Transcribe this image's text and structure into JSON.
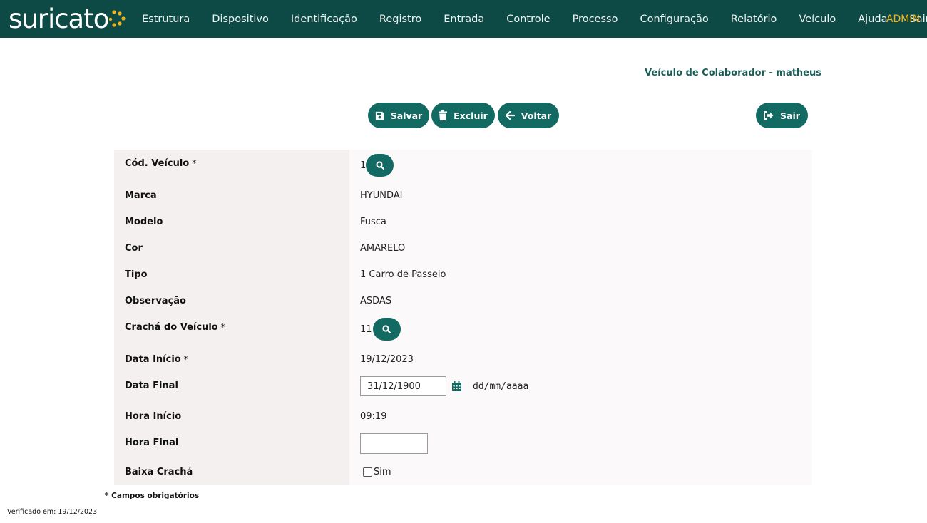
{
  "app": {
    "logo_text": "suricato",
    "user_label": "ADMIN"
  },
  "nav": {
    "items": [
      "Estrutura",
      "Dispositivo",
      "Identificação",
      "Registro",
      "Entrada",
      "Controle",
      "Processo",
      "Configuração",
      "Relatório",
      "Veículo",
      "Ajuda",
      "Sair"
    ]
  },
  "page": {
    "title": "Veículo de Colaborador - matheus"
  },
  "toolbar": {
    "save_label": "Salvar",
    "delete_label": "Excluir",
    "back_label": "Voltar",
    "exit_label": "Sair"
  },
  "form": {
    "required_mark": "*",
    "cod_veiculo": {
      "label": "Cód. Veículo",
      "value": "1"
    },
    "marca": {
      "label": "Marca",
      "value": "HYUNDAI"
    },
    "modelo": {
      "label": "Modelo",
      "value": "Fusca"
    },
    "cor": {
      "label": "Cor",
      "value": "AMARELO"
    },
    "tipo": {
      "label": "Tipo",
      "value": "1 Carro de Passeio"
    },
    "observacao": {
      "label": "Observação",
      "value": "ASDAS"
    },
    "cracha": {
      "label": "Crachá do Veículo",
      "value": "11"
    },
    "data_inicio": {
      "label": "Data Início",
      "value": "19/12/2023"
    },
    "data_final": {
      "label": "Data Final",
      "value": "31/12/1900",
      "format_hint": "dd/mm/aaaa"
    },
    "hora_inicio": {
      "label": "Hora Início",
      "value": "09:19"
    },
    "hora_final": {
      "label": "Hora Final",
      "value": ""
    },
    "baixa_cracha": {
      "label": "Baixa Crachá",
      "option_label": "Sim",
      "checked": false
    }
  },
  "footer": {
    "required_note": "* Campos obrigatórios",
    "verified": "Verificado em: 19/12/2023"
  },
  "colors": {
    "header_bg": "#0e4a45",
    "accent": "#136a63",
    "admin": "#f0b21b",
    "logo_dots": "#f0b21b"
  }
}
